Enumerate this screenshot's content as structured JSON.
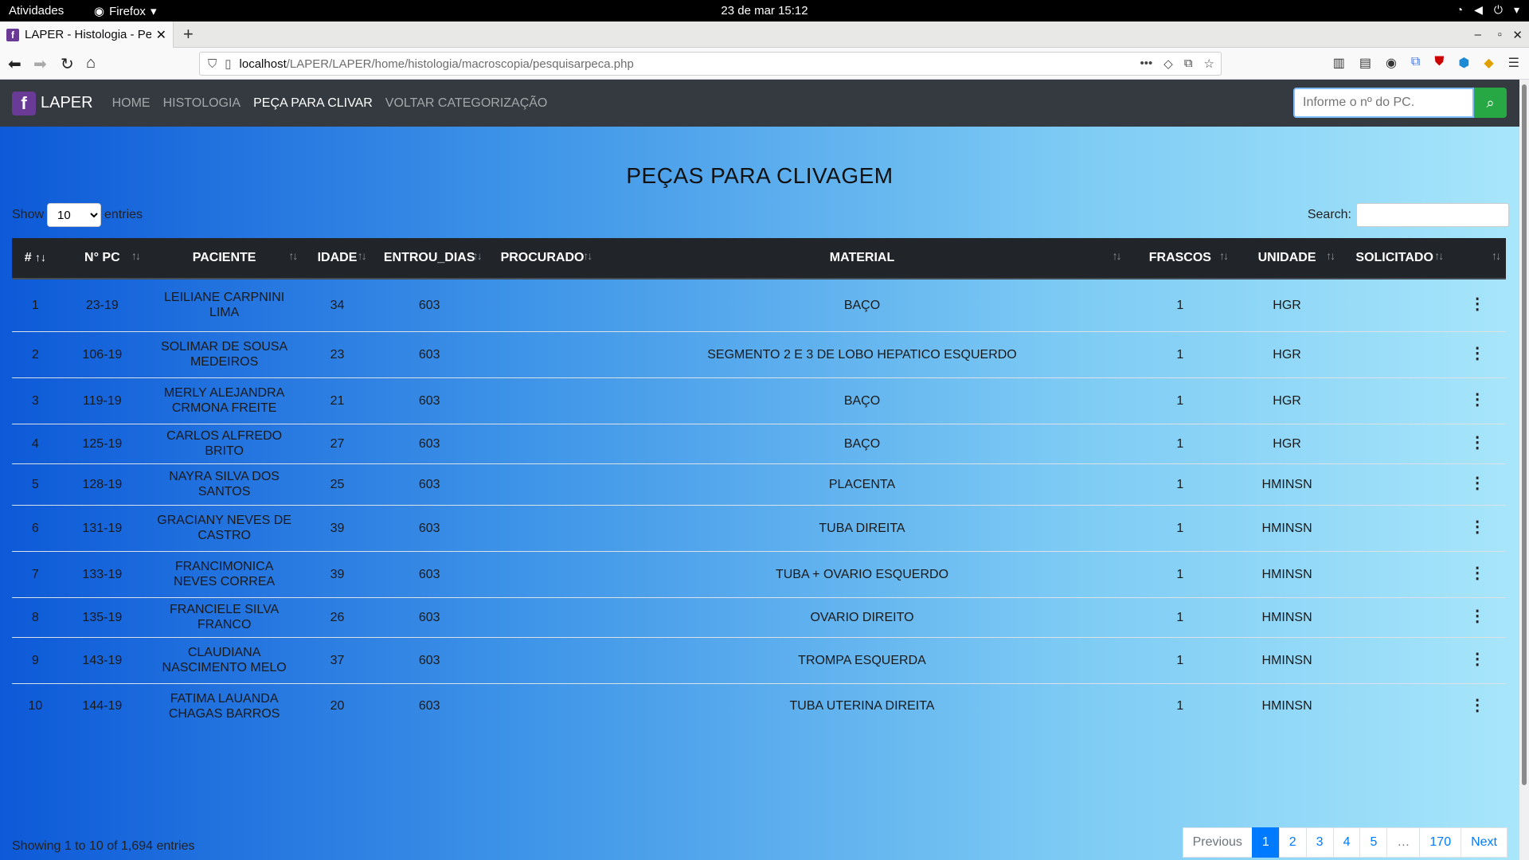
{
  "os": {
    "activities": "Atividades",
    "app": "Firefox",
    "clock": "23 de mar  15:12"
  },
  "browser": {
    "tab_title": "LAPER - Histologia - Pesquisa",
    "url_prefix": "localhost",
    "url_path": "/LAPER/LAPER/home/histologia/macroscopia/pesquisarpeca.php"
  },
  "nav": {
    "brand": "LAPER",
    "links": [
      "HOME",
      "HISTOLOGIA",
      "PEÇA PARA CLIVAR",
      "VOLTAR CATEGORIZAÇÃO"
    ],
    "search_placeholder": "Informe o nº do PC."
  },
  "page": {
    "title": "PEÇAS PARA CLIVAGEM",
    "show_label": "Show",
    "entries_label": "entries",
    "page_length": "10",
    "search_label": "Search:",
    "info": "Showing 1 to 10 of 1,694 entries"
  },
  "table": {
    "headers": [
      "#",
      "N° PC",
      "PACIENTE",
      "IDADE",
      "ENTROU_DIAS",
      "PROCURADO",
      "MATERIAL",
      "FRASCOS",
      "UNIDADE",
      "SOLICITADO",
      ""
    ],
    "rows": [
      [
        "1",
        "23-19",
        "LEILIANE CARPNINI LIMA",
        "34",
        "603",
        "",
        "BAÇO",
        "1",
        "HGR",
        ""
      ],
      [
        "2",
        "106-19",
        "SOLIMAR DE SOUSA MEDEIROS",
        "23",
        "603",
        "",
        "SEGMENTO 2 E 3 DE LOBO HEPATICO ESQUERDO",
        "1",
        "HGR",
        ""
      ],
      [
        "3",
        "119-19",
        "MERLY ALEJANDRA CRMONA FREITE",
        "21",
        "603",
        "",
        "BAÇO",
        "1",
        "HGR",
        ""
      ],
      [
        "4",
        "125-19",
        "CARLOS ALFREDO BRITO",
        "27",
        "603",
        "",
        "BAÇO",
        "1",
        "HGR",
        ""
      ],
      [
        "5",
        "128-19",
        "NAYRA SILVA DOS SANTOS",
        "25",
        "603",
        "",
        "PLACENTA",
        "1",
        "HMINSN",
        ""
      ],
      [
        "6",
        "131-19",
        "GRACIANY NEVES DE CASTRO",
        "39",
        "603",
        "",
        "TUBA DIREITA",
        "1",
        "HMINSN",
        ""
      ],
      [
        "7",
        "133-19",
        "FRANCIMONICA NEVES CORREA",
        "39",
        "603",
        "",
        "TUBA + OVARIO ESQUERDO",
        "1",
        "HMINSN",
        ""
      ],
      [
        "8",
        "135-19",
        "FRANCIELE SILVA FRANCO",
        "26",
        "603",
        "",
        "OVARIO DIREITO",
        "1",
        "HMINSN",
        ""
      ],
      [
        "9",
        "143-19",
        "CLAUDIANA NASCIMENTO MELO",
        "37",
        "603",
        "",
        "TROMPA ESQUERDA",
        "1",
        "HMINSN",
        ""
      ],
      [
        "10",
        "144-19",
        "FATIMA LAUANDA CHAGAS BARROS",
        "20",
        "603",
        "",
        "TUBA UTERINA DIREITA",
        "1",
        "HMINSN",
        ""
      ]
    ]
  },
  "pagination": {
    "prev": "Previous",
    "pages": [
      "1",
      "2",
      "3",
      "4",
      "5",
      "…",
      "170"
    ],
    "next": "Next",
    "active": "1"
  }
}
